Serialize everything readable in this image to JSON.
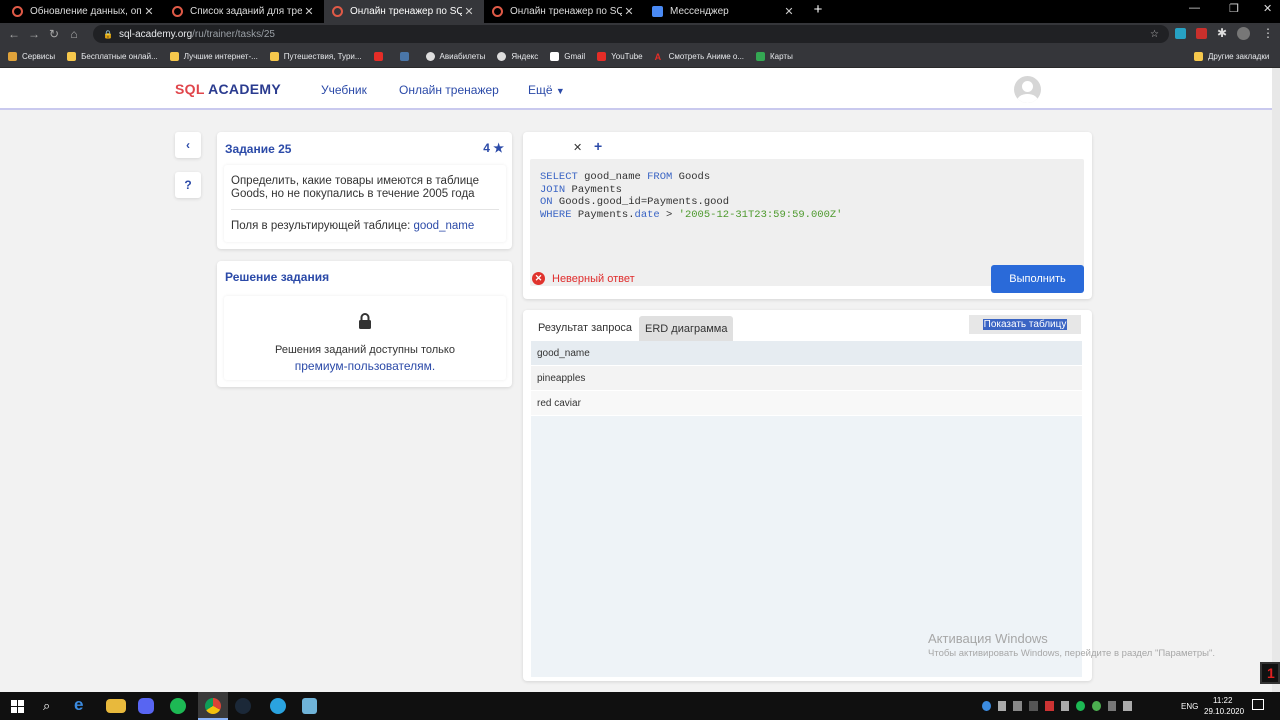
{
  "browser": {
    "tabs": [
      {
        "title": "Обновление данных, оператор",
        "active": false
      },
      {
        "title": "Список заданий для тренировк",
        "active": false
      },
      {
        "title": "Онлайн тренажер по SQL",
        "active": true
      },
      {
        "title": "Онлайн тренажер по SQL",
        "active": false
      },
      {
        "title": "Мессенджер",
        "active": false
      }
    ],
    "url_host": "sql-academy.org",
    "url_path": "/ru/trainer/tasks/25",
    "bookmarks": [
      "Сервисы",
      "Бесплатные онлай...",
      "Лучшие интернет-...",
      "Путешествия, Тури...",
      "",
      "",
      "Авиабилеты",
      "Яндекс",
      "Gmail",
      "YouTube",
      "Смотреть Аниме о...",
      "Карты"
    ],
    "other_bookmarks": "Другие закладки"
  },
  "site": {
    "logo_sql": "SQL",
    "logo_academy": "ACADEMY",
    "nav": [
      "Учебник",
      "Онлайн тренажер",
      "Ещё"
    ]
  },
  "task": {
    "title": "Задание 25",
    "stars": "4",
    "description": "Определить, какие товары имеются в таблице Goods, но не покупались в течение 2005 года",
    "fields_label": "Поля в результирующей таблице:",
    "fields_value": "good_name"
  },
  "solution": {
    "title": "Решение задания",
    "locked_text": "Решения заданий доступны только",
    "locked_link": "премиум-пользователям."
  },
  "side_buttons": {
    "back": "‹",
    "help": "?"
  },
  "editor": {
    "line1": {
      "kw1": "SELECT",
      "t1": " good_name ",
      "kw2": "FROM",
      "t2": " Goods"
    },
    "line2": {
      "kw1": "JOIN",
      "t1": " Payments"
    },
    "line3": {
      "kw1": "ON",
      "t1": " Goods.good_id=Payments.good"
    },
    "line4": {
      "kw1": "WHERE",
      "t1": " Payments.",
      "kw2": "date",
      "t2": " > ",
      "str": "'2005-12-31T23:59:59.000Z'"
    }
  },
  "result_status": "Неверный ответ",
  "run_button": "Выполнить",
  "results": {
    "tabs": [
      "Результат запроса",
      "ERD диаграмма"
    ],
    "show_table": "Показать таблицу",
    "column": "good_name",
    "rows": [
      "pineapples",
      "red caviar"
    ]
  },
  "watermark": {
    "line1": "Активация Windows",
    "line2": "Чтобы активировать Windows, перейдите в раздел \"Параметры\"."
  },
  "taskbar": {
    "lang": "ENG",
    "time": "11:22",
    "date": "29.10.2020"
  },
  "colors": {
    "accent": "#2b4aa8",
    "button": "#2a6ad9",
    "error": "#e02b2b",
    "logo_red": "#e0454b"
  }
}
